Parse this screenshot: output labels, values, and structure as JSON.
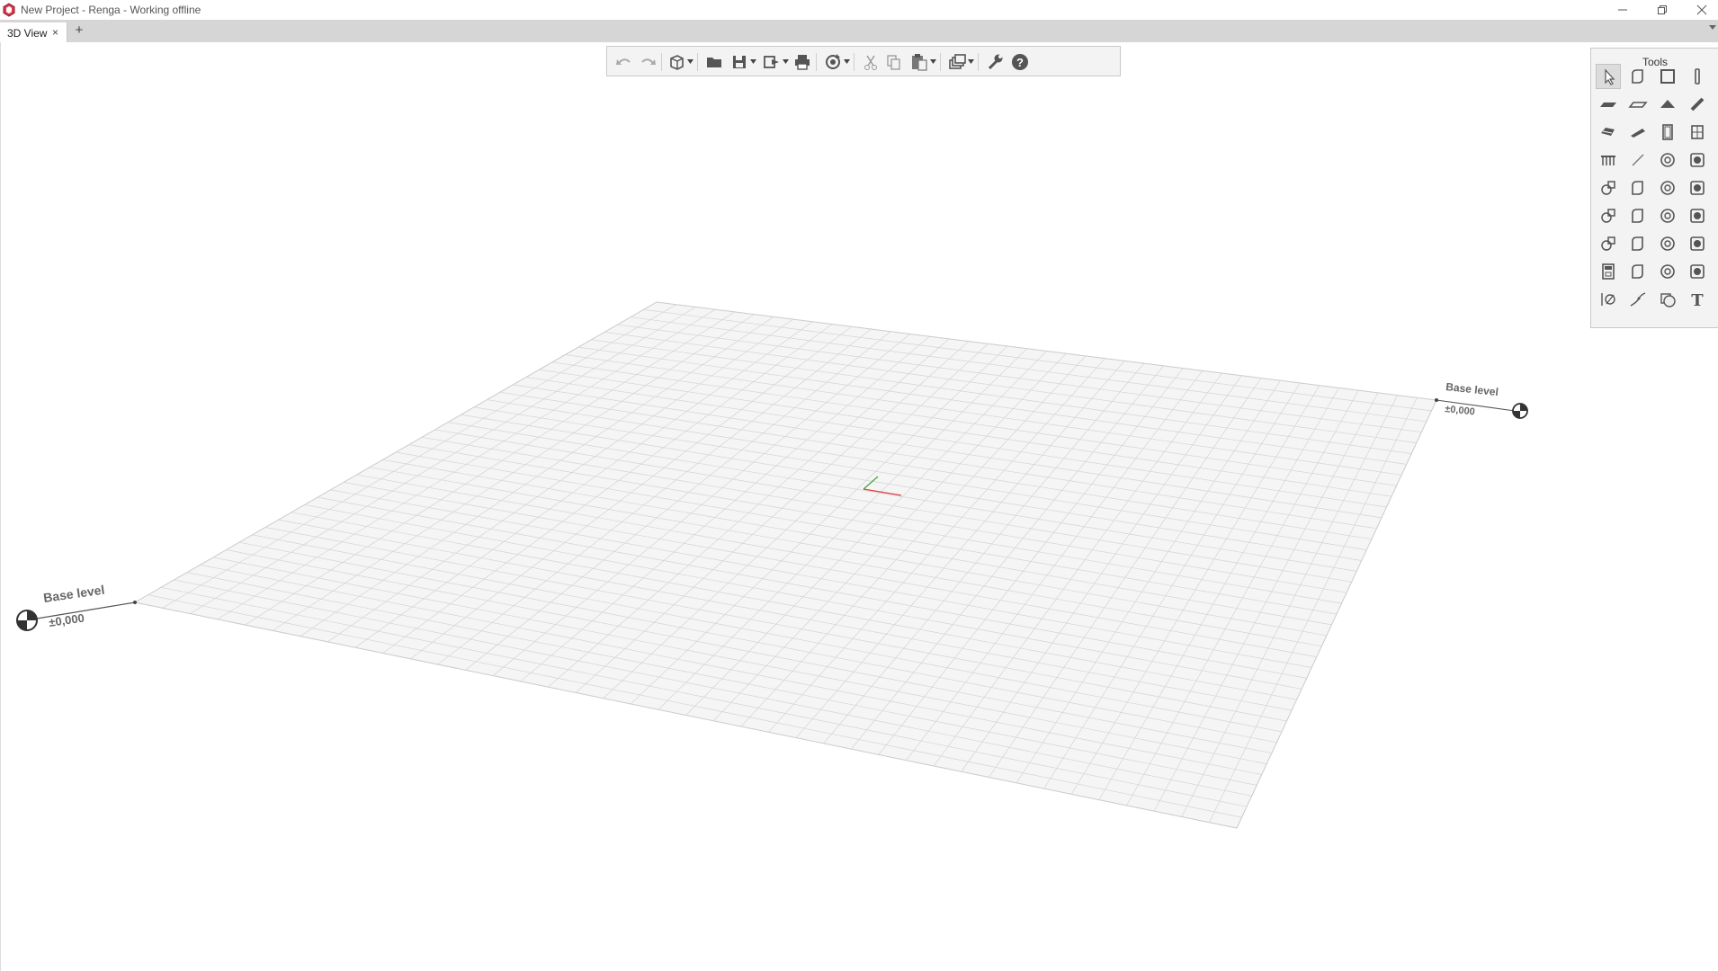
{
  "window": {
    "title": "New Project - Renga - Working offline",
    "app_icon": "renga-logo-icon",
    "controls": [
      "minimize-icon",
      "restore-icon",
      "close-icon"
    ]
  },
  "tabs": {
    "items": [
      {
        "label": "3D View",
        "close": "×",
        "active": true
      }
    ],
    "add_label": "+"
  },
  "toolbar": {
    "buttons": [
      "undo-icon",
      "redo-icon",
      "view-cube-icon",
      "open-folder-icon",
      "save-icon",
      "export-icon",
      "print-icon",
      "sync-icon",
      "cut-icon",
      "copy-icon",
      "paste-icon",
      "layers-icon",
      "settings-wrench-icon",
      "help-icon"
    ]
  },
  "tools": {
    "title": "Tools",
    "items": [
      "select-icon",
      "assembly-icon",
      "wall-icon",
      "column-icon",
      "floor-icon",
      "opening-icon",
      "roof-icon",
      "beam-icon",
      "stair-icon",
      "ramp-icon",
      "door-icon",
      "window-icon",
      "railing-icon",
      "line-icon",
      "equipment-icon",
      "duct-icon",
      "pipe-fitting-icon",
      "plumbing-fixture-icon",
      "mechanical-icon",
      "accessory-icon",
      "pipe-icon",
      "duct-fitting-icon",
      "duct-accessory-icon",
      "air-terminal-icon",
      "electric-icon",
      "lighting-icon",
      "circuit-icon",
      "panel-icon",
      "room-icon",
      "element-icon",
      "model-text-icon",
      "wire-icon",
      "axis-icon",
      "route-icon",
      "hatch-icon",
      "text-icon"
    ],
    "text_tool_label": "T"
  },
  "scene": {
    "levels": [
      {
        "name": "Base level",
        "elevation": "±0,000"
      },
      {
        "name": "Base level",
        "elevation": "±0,000"
      }
    ],
    "grid": true,
    "axis_colors": {
      "x": "#e03c3c",
      "y": "#3cae3c"
    }
  }
}
